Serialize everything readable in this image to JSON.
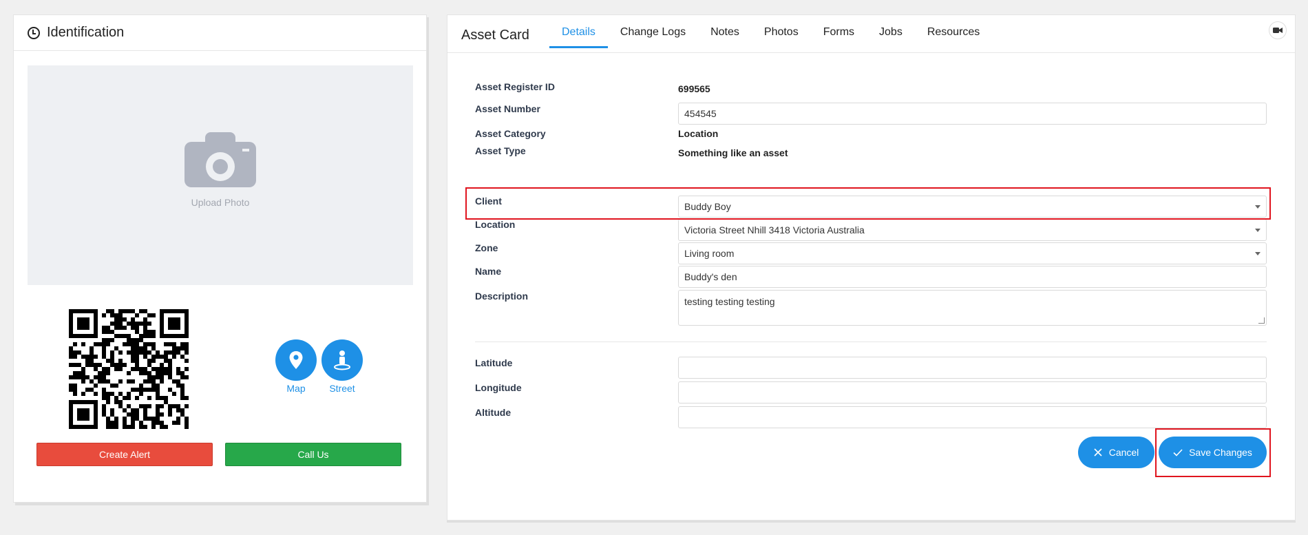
{
  "left": {
    "title": "Identification",
    "upload_label": "Upload Photo",
    "map_label": "Map",
    "street_label": "Street",
    "create_alert": "Create Alert",
    "call_us": "Call Us"
  },
  "asset_card": {
    "title": "Asset Card",
    "tabs": [
      "Details",
      "Change Logs",
      "Notes",
      "Photos",
      "Forms",
      "Jobs",
      "Resources"
    ],
    "active_tab": "Details",
    "fields": {
      "register_id_label": "Asset Register ID",
      "register_id_value": "699565",
      "asset_number_label": "Asset Number",
      "asset_number_value": "454545",
      "category_label": "Asset Category",
      "category_value": "Location",
      "type_label": "Asset Type",
      "type_value": "Something like an asset",
      "client_label": "Client",
      "client_value": "Buddy Boy",
      "location_label": "Location",
      "location_value": "Victoria Street Nhill 3418 Victoria Australia",
      "zone_label": "Zone",
      "zone_value": "Living room",
      "name_label": "Name",
      "name_value": "Buddy's den",
      "description_label": "Description",
      "description_value": "testing testing testing",
      "latitude_label": "Latitude",
      "latitude_value": "",
      "longitude_label": "Longitude",
      "longitude_value": "",
      "altitude_label": "Altitude",
      "altitude_value": ""
    },
    "cancel_label": "Cancel",
    "save_label": "Save Changes"
  },
  "colors": {
    "accent": "#1e90e6",
    "danger": "#e84c3d",
    "success": "#27a84a",
    "highlight": "#e0141e"
  }
}
